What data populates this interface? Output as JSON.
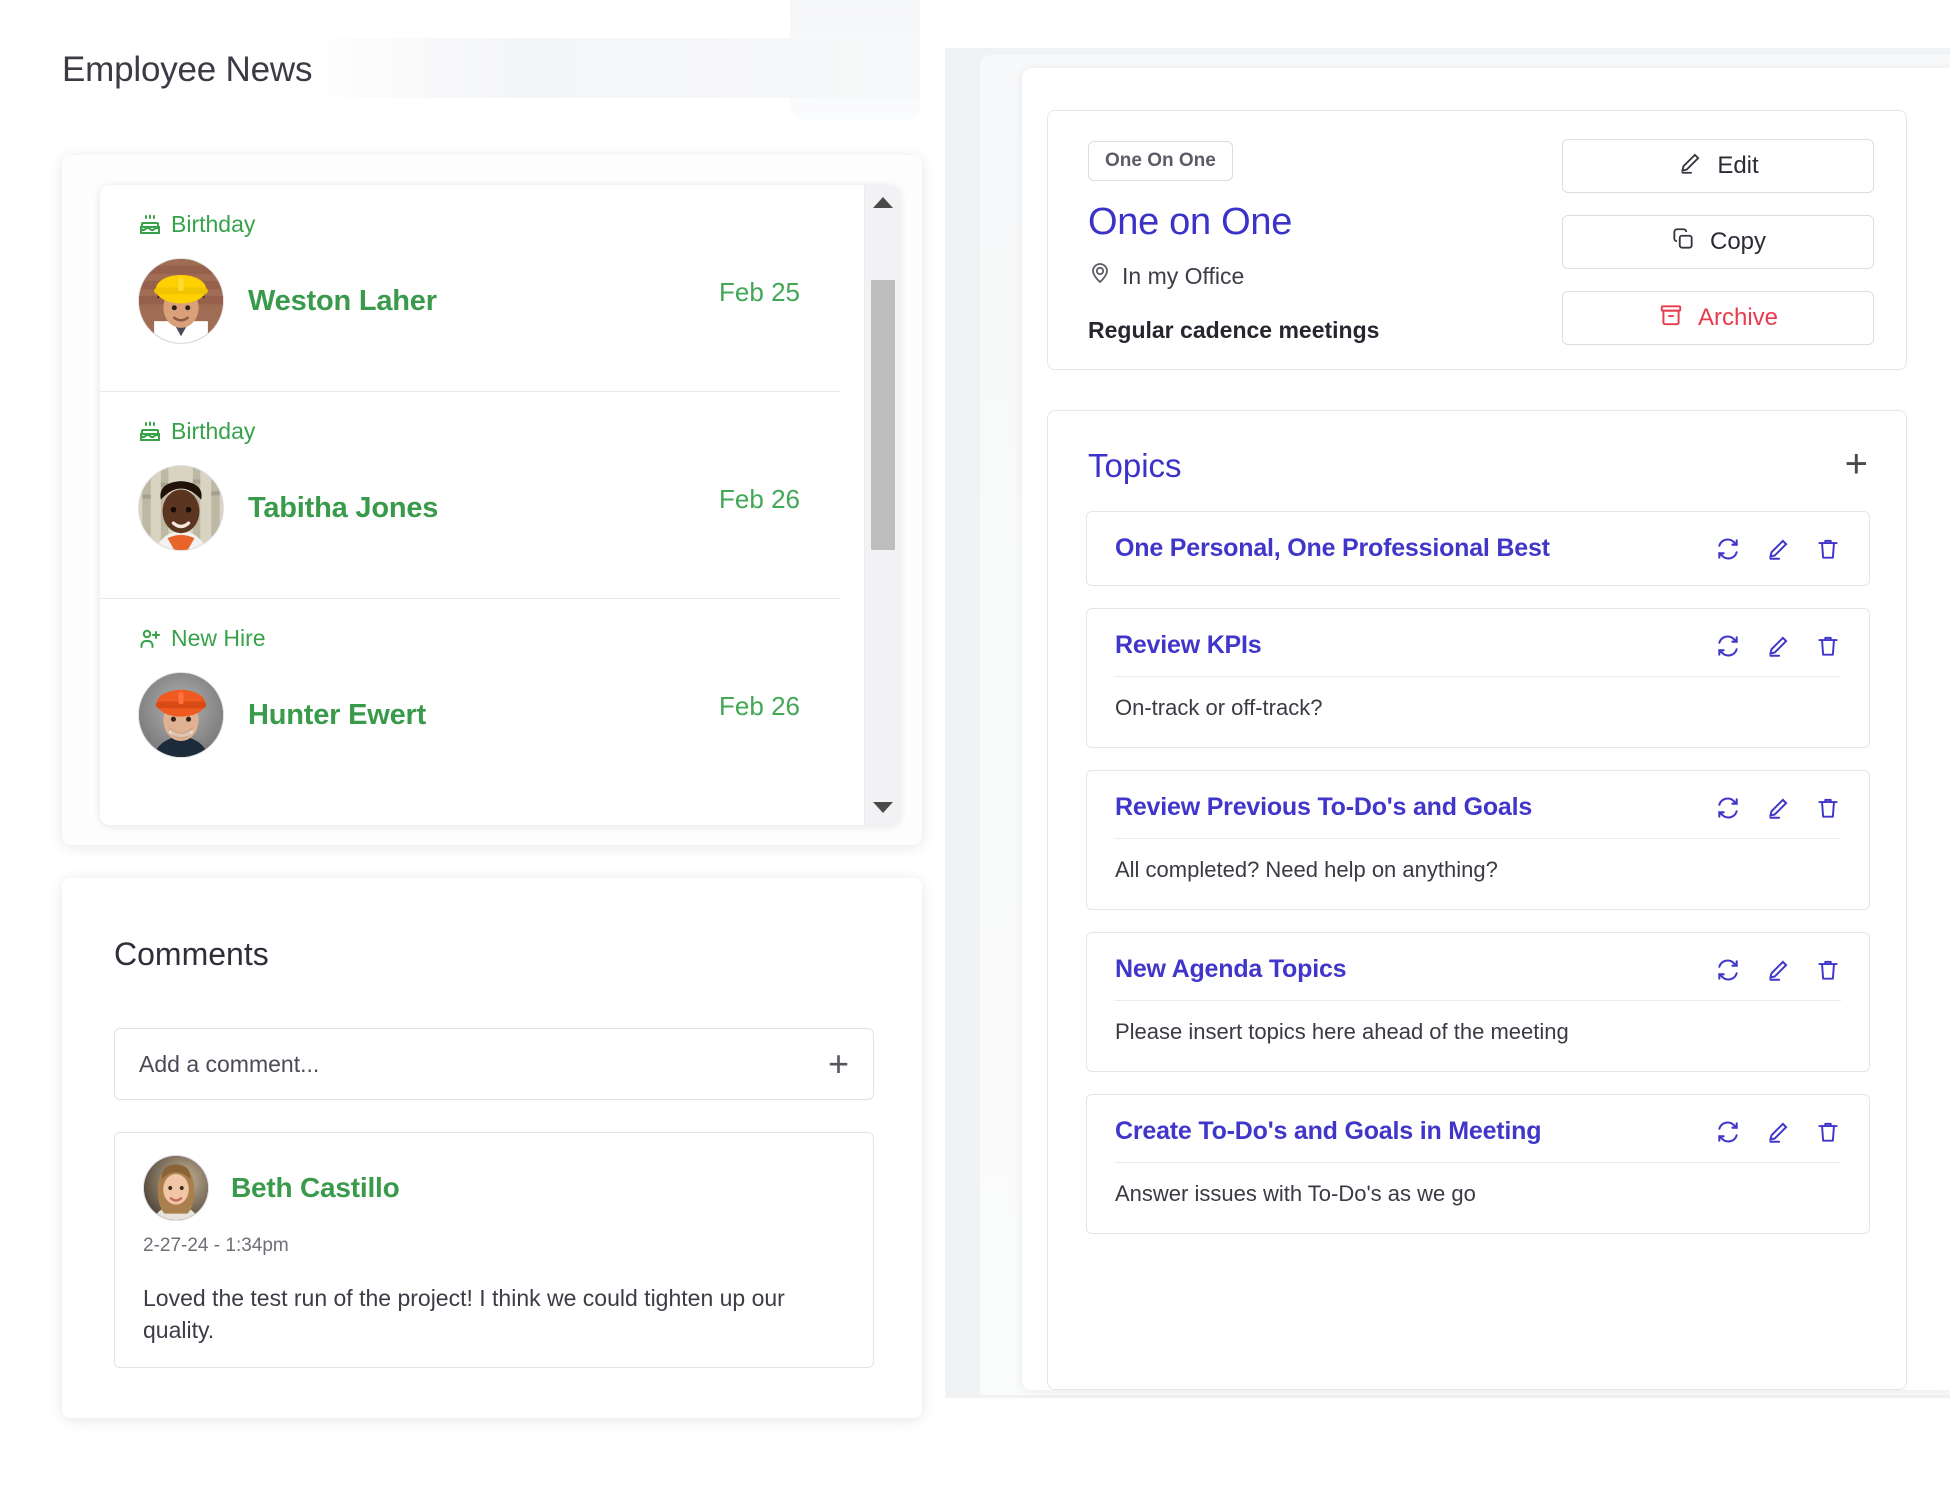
{
  "page": {
    "title": "Employee News"
  },
  "news": {
    "items": [
      {
        "badge": "Birthday",
        "badge_icon": "cake-icon",
        "name": "Weston Laher",
        "date": "Feb 25",
        "avatar": "man-yellow-hardhat-avatar"
      },
      {
        "badge": "Birthday",
        "badge_icon": "cake-icon",
        "name": "Tabitha Jones",
        "date": "Feb 26",
        "avatar": "woman-orange-vest-avatar"
      },
      {
        "badge": "New Hire",
        "badge_icon": "user-plus-icon",
        "name": "Hunter Ewert",
        "date": "Feb 26",
        "avatar": "man-orange-hardhat-avatar"
      }
    ],
    "scrollbar": {
      "up_icon": "triangle-up-icon",
      "down_icon": "triangle-down-icon"
    }
  },
  "comments": {
    "title": "Comments",
    "input_placeholder": "Add a comment...",
    "add_icon": "plus-icon",
    "items": [
      {
        "author": "Beth Castillo",
        "timestamp": "2-27-24 - 1:34pm",
        "body": "Loved the test run of the project! I think we could tighten up our quality.",
        "avatar": "woman-blonde-avatar"
      }
    ]
  },
  "meeting": {
    "type_badge": "One On One",
    "title": "One on One",
    "location": "In my Office",
    "location_icon": "map-pin-icon",
    "description": "Regular cadence meetings",
    "actions": [
      {
        "label": "Edit",
        "icon": "pencil-icon"
      },
      {
        "label": "Copy",
        "icon": "copy-icon"
      },
      {
        "label": "Archive",
        "icon": "archive-icon"
      }
    ]
  },
  "topics": {
    "heading": "Topics",
    "add_icon": "plus-icon",
    "row_icons": [
      "refresh-icon",
      "pencil-icon",
      "trash-icon"
    ],
    "items": [
      {
        "name": "One Personal, One Professional Best",
        "description": ""
      },
      {
        "name": "Review KPIs",
        "description": "On-track or off-track?"
      },
      {
        "name": "Review Previous To-Do's and Goals",
        "description": "All completed? Need help on anything?"
      },
      {
        "name": "New Agenda Topics",
        "description": "Please insert topics here ahead of the meeting"
      },
      {
        "name": "Create To-Do's and Goals in Meeting",
        "description": "Answer issues with To-Do's as we go"
      }
    ]
  },
  "colors": {
    "green": "#3a9a4b",
    "indigo": "#3b32c8",
    "topic_indigo": "#4036c9",
    "archive_red": "#e83b4e",
    "text_dark": "#3c3c46"
  }
}
